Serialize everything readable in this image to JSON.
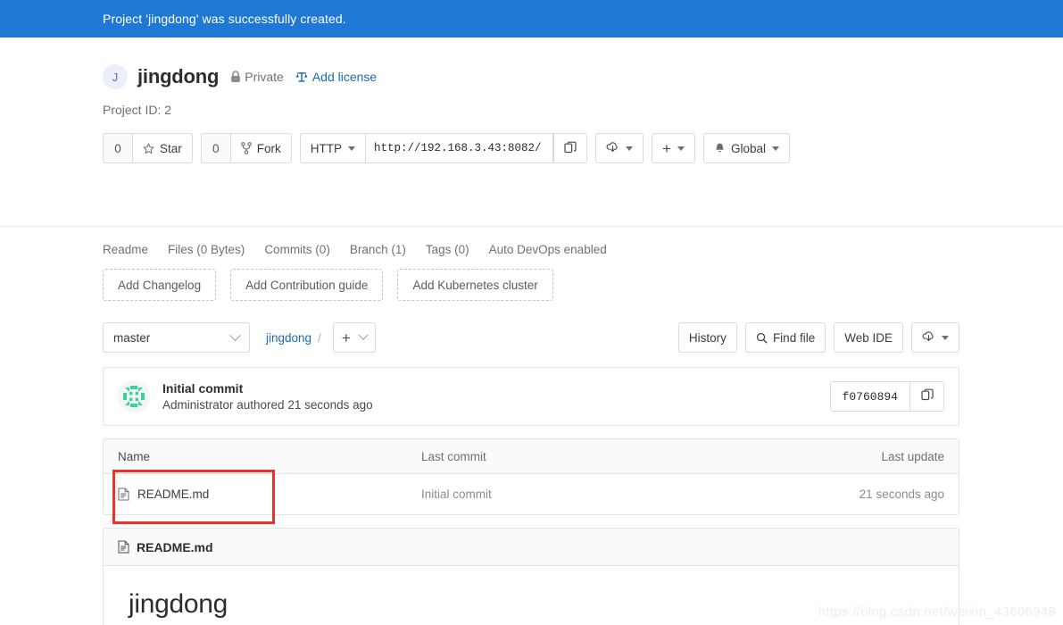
{
  "flash": {
    "message": "Project 'jingdong' was successfully created."
  },
  "project": {
    "avatar_letter": "J",
    "name": "jingdong",
    "visibility": "Private",
    "add_license": "Add license",
    "project_id_label": "Project ID: 2"
  },
  "actions": {
    "star_count": "0",
    "star_label": "Star",
    "fork_count": "0",
    "fork_label": "Fork",
    "protocol": "HTTP",
    "clone_url": "http://192.168.3.43:8082/",
    "notification_label": "Global"
  },
  "stats_nav": [
    {
      "label": "Readme"
    },
    {
      "label": "Files (0 Bytes)"
    },
    {
      "label": "Commits (0)"
    },
    {
      "label": "Branch (1)"
    },
    {
      "label": "Tags (0)"
    },
    {
      "label": "Auto DevOps enabled"
    }
  ],
  "quick_actions": [
    {
      "label": "Add Changelog"
    },
    {
      "label": "Add Contribution guide"
    },
    {
      "label": "Add Kubernetes cluster"
    }
  ],
  "tree_controls": {
    "branch": "master",
    "breadcrumb_root": "jingdong",
    "breadcrumb_sep": "/",
    "history_label": "History",
    "find_file_label": "Find file",
    "web_ide_label": "Web IDE"
  },
  "commit": {
    "title": "Initial commit",
    "author_line": "Administrator authored 21 seconds ago",
    "sha": "f0760894"
  },
  "file_table": {
    "headers": {
      "name": "Name",
      "last_commit": "Last commit",
      "last_update": "Last update"
    },
    "rows": [
      {
        "name": "README.md",
        "last_commit": "Initial commit",
        "last_update": "21 seconds ago"
      }
    ]
  },
  "readme": {
    "file_name": "README.md",
    "heading": "jingdong"
  },
  "watermark": {
    "text": "https://blog.csdn.net/weixin_43606948"
  },
  "colors": {
    "flash_blue": "#1f78d1",
    "link_blue": "#1b69b6",
    "annotation_red": "#e8332a",
    "border_gray": "#dbdbdb"
  }
}
